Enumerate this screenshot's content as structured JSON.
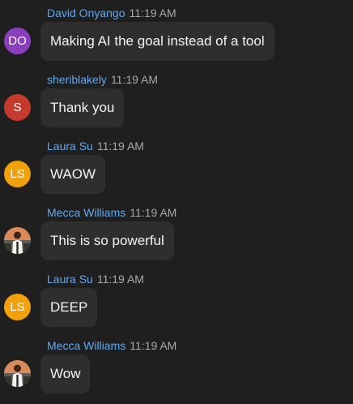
{
  "messages": [
    {
      "sender": "David Onyango",
      "time": "11:19 AM",
      "text": "Making AI the goal instead of a tool",
      "avatar": {
        "type": "initials",
        "initials": "DO",
        "color": "#8a3dbd"
      }
    },
    {
      "sender": "sheriblakely",
      "time": "11:19 AM",
      "text": "Thank you",
      "avatar": {
        "type": "initials",
        "initials": "S",
        "color": "#c53a2d"
      }
    },
    {
      "sender": "Laura Su",
      "time": "11:19 AM",
      "text": "WAOW",
      "avatar": {
        "type": "initials",
        "initials": "LS",
        "color": "#f0a10c"
      }
    },
    {
      "sender": "Mecca Williams",
      "time": "11:19 AM",
      "text": "This is so powerful",
      "avatar": {
        "type": "photo",
        "icon": "person-photo-icon"
      }
    },
    {
      "sender": "Laura Su",
      "time": "11:19 AM",
      "text": "DEEP",
      "avatar": {
        "type": "initials",
        "initials": "LS",
        "color": "#f0a10c"
      }
    },
    {
      "sender": "Mecca Williams",
      "time": "11:19 AM",
      "text": "Wow",
      "avatar": {
        "type": "photo",
        "icon": "person-photo-icon"
      }
    }
  ],
  "colors": {
    "background": "#1f1f1f",
    "bubble": "#2e2e2e",
    "sender_name": "#62a8ee",
    "timestamp": "#a8a8a8",
    "message_text": "#f3f3f3"
  }
}
